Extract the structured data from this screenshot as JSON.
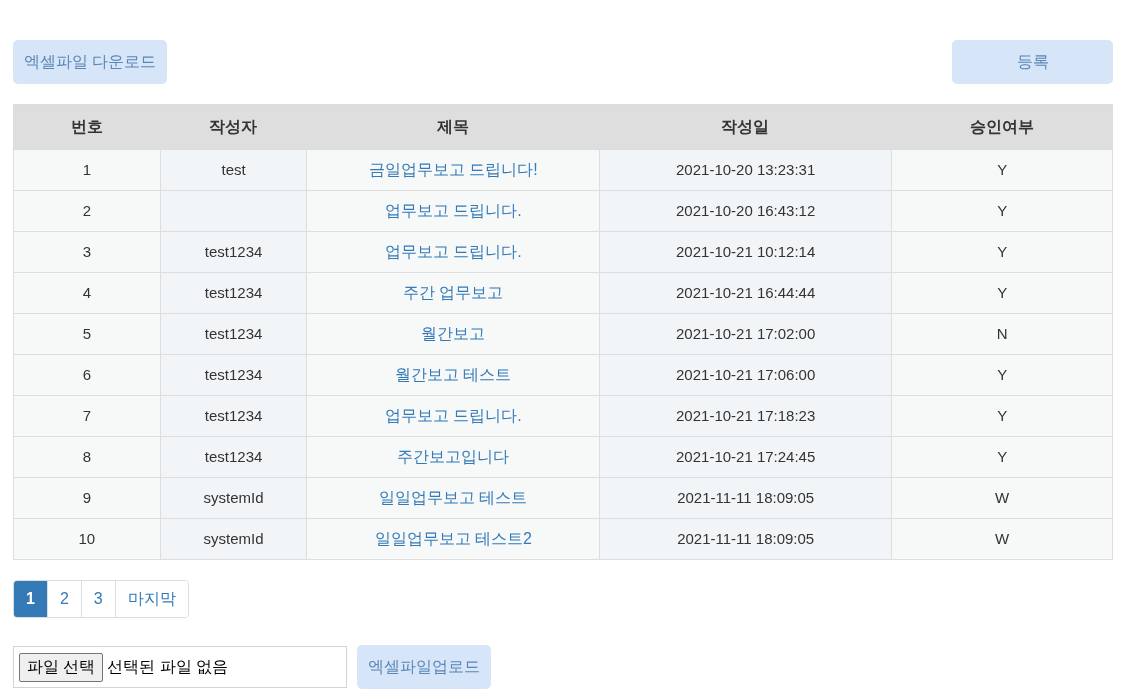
{
  "toolbar": {
    "download_button": "엑셀파일 다운로드",
    "register_button": "등록"
  },
  "table": {
    "columns": [
      "번호",
      "작성자",
      "제목",
      "작성일",
      "승인여부"
    ],
    "rows": [
      {
        "number": "1",
        "author": "test",
        "title": "금일업무보고 드립니다!",
        "date": "2021-10-20 13:23:31",
        "approved": "Y"
      },
      {
        "number": "2",
        "author": "",
        "title": "업무보고 드립니다.",
        "date": "2021-10-20 16:43:12",
        "approved": "Y"
      },
      {
        "number": "3",
        "author": "test1234",
        "title": "업무보고 드립니다.",
        "date": "2021-10-21 10:12:14",
        "approved": "Y"
      },
      {
        "number": "4",
        "author": "test1234",
        "title": "주간 업무보고",
        "date": "2021-10-21 16:44:44",
        "approved": "Y"
      },
      {
        "number": "5",
        "author": "test1234",
        "title": "월간보고",
        "date": "2021-10-21 17:02:00",
        "approved": "N"
      },
      {
        "number": "6",
        "author": "test1234",
        "title": "월간보고 테스트",
        "date": "2021-10-21 17:06:00",
        "approved": "Y"
      },
      {
        "number": "7",
        "author": "test1234",
        "title": "업무보고 드립니다.",
        "date": "2021-10-21 17:18:23",
        "approved": "Y"
      },
      {
        "number": "8",
        "author": "test1234",
        "title": "주간보고입니다",
        "date": "2021-10-21 17:24:45",
        "approved": "Y"
      },
      {
        "number": "9",
        "author": "systemId",
        "title": "일일업무보고 테스트",
        "date": "2021-11-11 18:09:05",
        "approved": "W"
      },
      {
        "number": "10",
        "author": "systemId",
        "title": "일일업무보고 테스트2",
        "date": "2021-11-11 18:09:05",
        "approved": "W"
      }
    ]
  },
  "pagination": [
    {
      "label": "1",
      "selected": true
    },
    {
      "label": "2",
      "selected": false
    },
    {
      "label": "3",
      "selected": false
    },
    {
      "label": "마지막",
      "selected": false
    }
  ],
  "upload": {
    "choose_button": "파일 선택",
    "file_status": "선택된 파일 없음",
    "upload_button": "엑셀파일업로드"
  }
}
